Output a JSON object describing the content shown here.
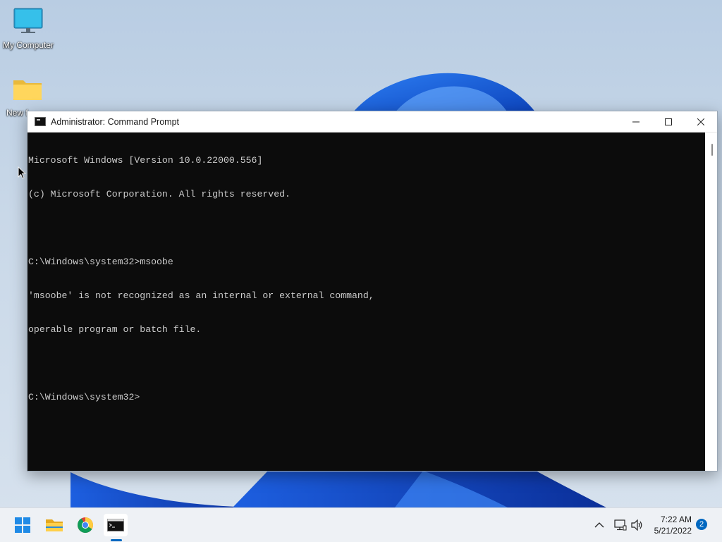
{
  "desktop": {
    "icons": [
      {
        "label": "My Computer",
        "icon": "monitor-icon"
      },
      {
        "label": "New f",
        "icon": "folder-icon"
      }
    ]
  },
  "window": {
    "title": "Administrator: Command Prompt",
    "controls": {
      "minimize": "minimize-icon",
      "maximize": "maximize-icon",
      "close": "close-icon"
    },
    "console_lines": [
      "Microsoft Windows [Version 10.0.22000.556]",
      "(c) Microsoft Corporation. All rights reserved.",
      "",
      "C:\\Windows\\system32>msoobe",
      "'msoobe' is not recognized as an internal or external command,",
      "operable program or batch file.",
      "",
      "C:\\Windows\\system32>"
    ]
  },
  "taskbar": {
    "apps": [
      "start-icon",
      "file-explorer-icon",
      "chrome-icon",
      "command-prompt-icon"
    ],
    "tray": {
      "time": "7:22 AM",
      "date": "5/21/2022",
      "notification_count": "2"
    }
  },
  "colors": {
    "console_bg": "#0c0c0c",
    "console_fg": "#cccccc",
    "accent": "#0067c0"
  }
}
